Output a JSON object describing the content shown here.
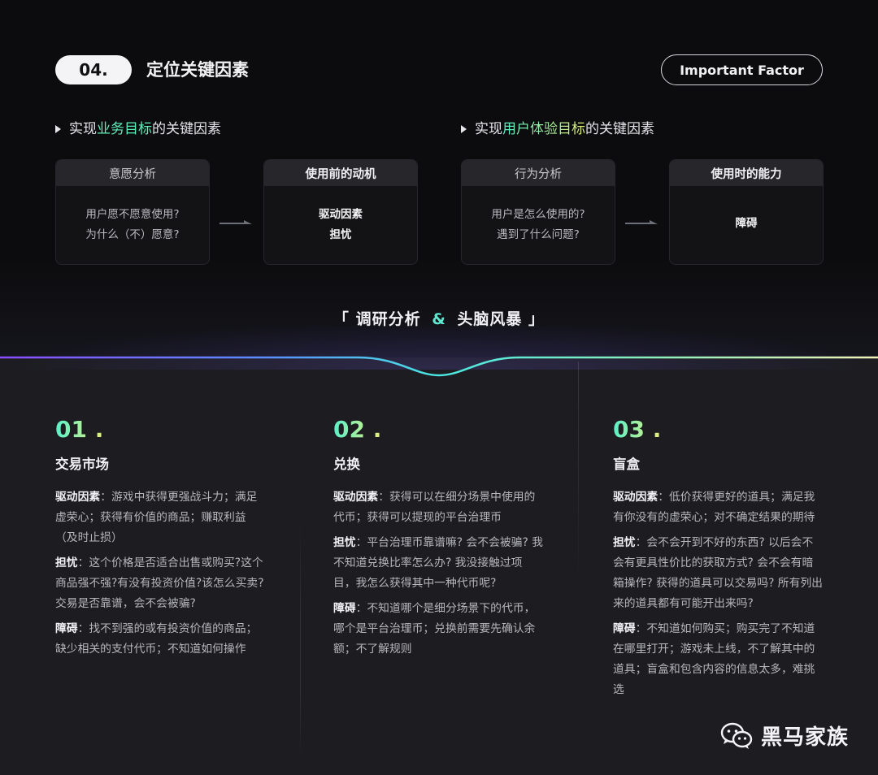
{
  "header": {
    "badge": "04.",
    "title": "定位关键因素",
    "pill": "Important Factor"
  },
  "sections": {
    "business": {
      "pre": "实现",
      "highlight": "业务目标",
      "post": "的关键因素"
    },
    "user": {
      "pre": "实现",
      "highlight": "用户体验目标",
      "post": "的关键因素"
    }
  },
  "boxes": [
    {
      "title": "意愿分析",
      "lines": [
        "用户愿不愿意使用?",
        "为什么（不）愿意?"
      ]
    },
    {
      "title": "使用前的动机",
      "lines": [
        "驱动因素",
        "担忧"
      ]
    },
    {
      "title": "行为分析",
      "lines": [
        "用户是怎么使用的?",
        "遇到了什么问题?"
      ]
    },
    {
      "title": "使用时的能力",
      "lines": [
        "障碍"
      ]
    }
  ],
  "center": {
    "left_bracket": "「",
    "part1": "调研分析",
    "amp": "&",
    "part2": "头脑风暴",
    "right_bracket": "」"
  },
  "columns": [
    {
      "num": "01 .",
      "title": "交易市场",
      "paras": [
        {
          "k": "驱动因素",
          "v": "：游戏中获得更强战斗力；满足虚荣心；获得有价值的商品；赚取利益（及时止损）"
        },
        {
          "k": "担忧",
          "v": "：这个价格是否适合出售或购买?这个商品强不强?有没有投资价值?该怎么买卖?交易是否靠谱，会不会被骗?"
        },
        {
          "k": "障碍",
          "v": "：找不到强的或有投资价值的商品；缺少相关的支付代币；不知道如何操作"
        }
      ]
    },
    {
      "num": "02 .",
      "title": "兑换",
      "paras": [
        {
          "k": "驱动因素",
          "v": "：获得可以在细分场景中使用的代币；获得可以提现的平台治理币"
        },
        {
          "k": "担忧",
          "v": "：平台治理币靠谱嘛? 会不会被骗? 我不知道兑换比率怎么办? 我没接触过项目，我怎么获得其中一种代币呢?"
        },
        {
          "k": "障碍",
          "v": "：不知道哪个是细分场景下的代币，哪个是平台治理币；兑换前需要先确认余额；不了解规则"
        }
      ]
    },
    {
      "num": "03 .",
      "title": "盲盒",
      "paras": [
        {
          "k": "驱动因素",
          "v": "：低价获得更好的道具；满足我有你没有的虚荣心；对不确定结果的期待"
        },
        {
          "k": "担忧",
          "v": "：会不会开到不好的东西? 以后会不会有更具性价比的获取方式? 会不会有暗箱操作? 获得的道具可以交易吗? 所有列出来的道具都有可能开出来吗?"
        },
        {
          "k": "障碍",
          "v": "：不知道如何购买；购买完了不知道在哪里打开；游戏未上线，不了解其中的道具；盲盒和包含内容的信息太多，难挑选"
        }
      ]
    }
  ],
  "footer": {
    "wechat_name": "黑马家族"
  }
}
